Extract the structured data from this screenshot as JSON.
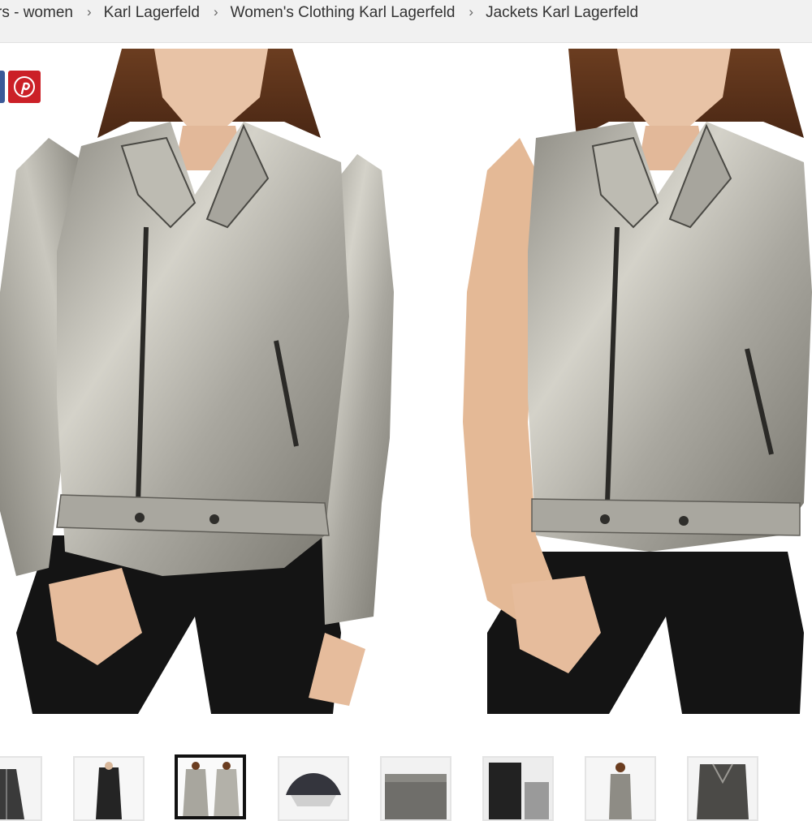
{
  "breadcrumb": {
    "items": [
      {
        "label": "rs - women"
      },
      {
        "label": "Karl Lagerfeld"
      },
      {
        "label": "Women's Clothing Karl Lagerfeld"
      },
      {
        "label": "Jackets Karl Lagerfeld"
      }
    ],
    "separator": "›"
  },
  "share": {
    "facebook_icon": "facebook-icon",
    "pinterest_icon": "pinterest-icon",
    "facebook_color": "#3b5998",
    "pinterest_color": "#cb2027"
  },
  "gallery": {
    "main_image": "product-photo-silver-metallic-biker-jacket-with-detachable-sleeves",
    "thumbnails": [
      {
        "name": "thumbnail-1"
      },
      {
        "name": "thumbnail-2"
      },
      {
        "name": "thumbnail-3",
        "selected": true
      },
      {
        "name": "thumbnail-4"
      },
      {
        "name": "thumbnail-5"
      },
      {
        "name": "thumbnail-6"
      },
      {
        "name": "thumbnail-7"
      },
      {
        "name": "thumbnail-8"
      }
    ]
  }
}
